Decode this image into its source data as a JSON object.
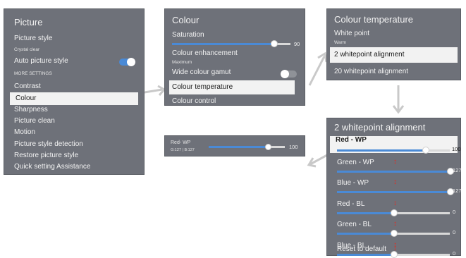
{
  "picture": {
    "title": "Picture",
    "picture_style": "Picture style",
    "picture_style_value": "Crystal clear",
    "auto_picture_style": "Auto picture style",
    "more_settings": "MORE SETTINGS",
    "items": [
      "Contrast",
      "Colour",
      "Sharpness",
      "Picture clean",
      "Motion",
      "Picture style detection",
      "Restore picture style",
      "Quick setting Assistance"
    ],
    "selected": "Colour",
    "auto_toggle_on": true
  },
  "colour": {
    "title": "Colour",
    "saturation": "Saturation",
    "saturation_value": "90",
    "saturation_fraction": 0.86,
    "colour_enhancement": "Colour enhancement",
    "colour_enhancement_value": "Maximum",
    "wide_colour_gamut": "Wide colour gamut",
    "wide_gamut_on": false,
    "colour_temperature": "Colour temperature",
    "colour_control": "Colour control"
  },
  "colour_temp": {
    "title": "Colour temperature",
    "white_point": "White point",
    "white_point_value": "Warm",
    "two_point": "2 whitepoint alignment",
    "twenty_point": "20 whitepoint alignment"
  },
  "mini": {
    "label": "Red- WP",
    "sub": "G:127 | B:127",
    "value": "100",
    "fraction": 0.78
  },
  "alignment": {
    "title": "2 whitepoint alignment",
    "items": [
      {
        "label": "Red - WP",
        "value": "100",
        "fraction": 0.78
      },
      {
        "label": "Green - WP",
        "value": "127",
        "fraction": 1.0
      },
      {
        "label": "Blue - WP",
        "value": "127",
        "fraction": 1.0
      },
      {
        "label": "Red - BL",
        "value": "0",
        "fraction": 0.5
      },
      {
        "label": "Green - BL",
        "value": "0",
        "fraction": 0.5
      },
      {
        "label": "Blue - BL",
        "value": "0",
        "fraction": 0.5
      }
    ],
    "reset": "Reset to default"
  },
  "colors": {
    "panel": "#6e7179",
    "accent": "#4a8ad6",
    "selected_bg": "#f2f2f2",
    "arrow": "#c9c9c9",
    "adjust_marker": "#d9342b"
  }
}
